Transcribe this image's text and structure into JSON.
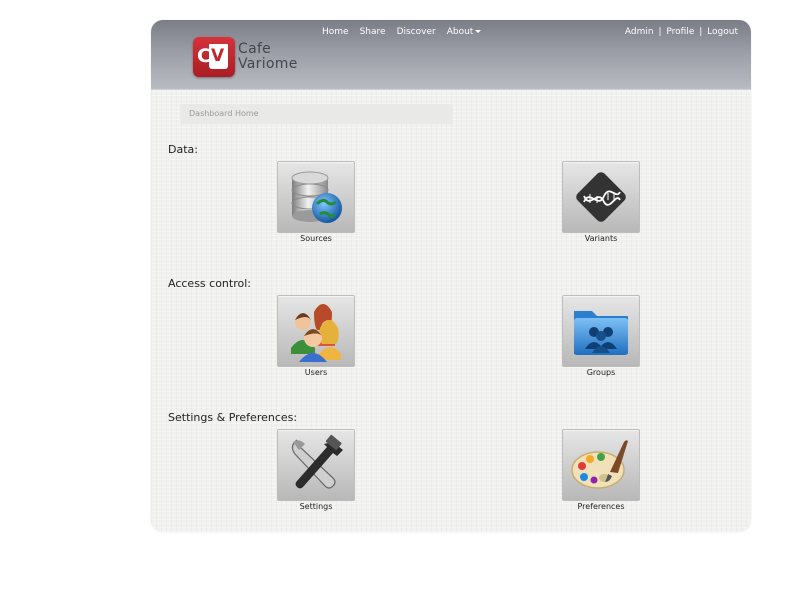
{
  "brand": {
    "line1": "Cafe",
    "line2": "Variome",
    "mark_left": "C",
    "mark_right": "V"
  },
  "nav": {
    "home": "Home",
    "share": "Share",
    "discover": "Discover",
    "about": "About"
  },
  "account": {
    "admin": "Admin",
    "profile": "Profile",
    "logout": "Logout",
    "separator": "|"
  },
  "breadcrumb": "Dashboard Home",
  "sections": {
    "data": {
      "title": "Data:",
      "sources": {
        "label": "Sources",
        "icon": "database-globe-icon"
      },
      "variants": {
        "label": "Variants",
        "icon": "dna-icon"
      }
    },
    "access": {
      "title": "Access control:",
      "users": {
        "label": "Users",
        "icon": "users-icon"
      },
      "groups": {
        "label": "Groups",
        "icon": "groups-folder-icon"
      }
    },
    "settings": {
      "title": "Settings & Preferences:",
      "settings": {
        "label": "Settings",
        "icon": "wrench-hammer-icon"
      },
      "preferences": {
        "label": "Preferences",
        "icon": "paint-palette-icon"
      }
    }
  },
  "colors": {
    "brand_red": "#c0262d",
    "header_top": "#7a7d86",
    "header_bottom": "#b9bbc2"
  }
}
